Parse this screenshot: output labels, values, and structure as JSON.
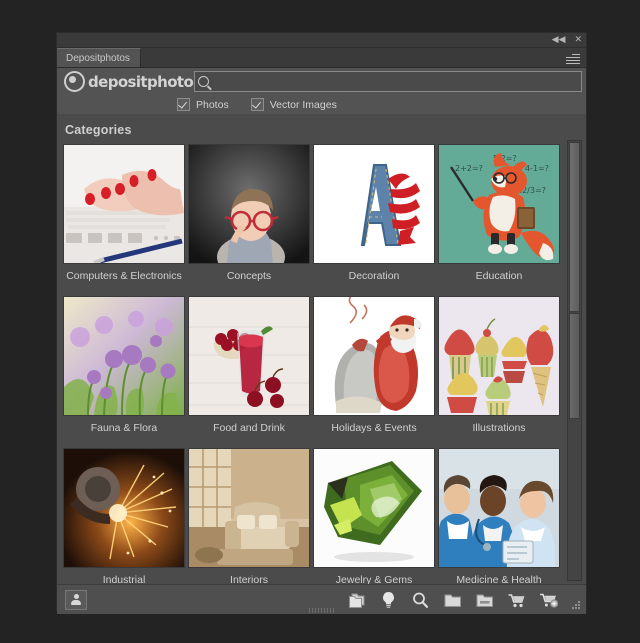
{
  "window": {
    "collapse_icon": "collapse-arrows-icon",
    "collapse_glyph": "◀◀",
    "close_glyph": "✕",
    "tab_label": "Depositphotos",
    "panel_menu_icon": "panel-menu-icon"
  },
  "brand": {
    "logo_text": "depositphotos",
    "logo_mark": "camera-aperture-icon"
  },
  "search": {
    "value": "",
    "placeholder": "",
    "icon": "search-icon"
  },
  "filters": [
    {
      "label": "Photos",
      "checked": true
    },
    {
      "label": "Vector Images",
      "checked": true
    }
  ],
  "main": {
    "section_title": "Categories",
    "categories": [
      {
        "label": "Computers & Electronics",
        "thumb": "hands-typing-on-white-keyboard",
        "bg": "#f2f0ee"
      },
      {
        "label": "Concepts",
        "thumb": "boy-with-red-glasses-thinking",
        "bg": "#3a3a3a"
      },
      {
        "label": "Decoration",
        "thumb": "denim-letter-A-with-red-ribbon",
        "bg": "#ffffff"
      },
      {
        "label": "Education",
        "thumb": "fox-teacher-with-pointer-and-math-equations",
        "bg": "#62ab96"
      },
      {
        "label": "Fauna & Flora",
        "thumb": "purple-chive-flowers-in-green-field",
        "bg": "#9dbf6a"
      },
      {
        "label": "Food and Drink",
        "thumb": "cherry-juice-glass-with-cherries",
        "bg": "#efe9e5"
      },
      {
        "label": "Holidays & Events",
        "thumb": "santa-claus-carrying-gift-sack",
        "bg": "#ffffff"
      },
      {
        "label": "Illustrations",
        "thumb": "cupcakes-and-ice-cream-drawings",
        "bg": "#ece7ee"
      },
      {
        "label": "Industrial",
        "thumb": "grinder-sparks-metal-work",
        "bg": "#3b2318"
      },
      {
        "label": "Interiors",
        "thumb": "living-room-with-beige-sofa",
        "bg": "#cdb99a"
      },
      {
        "label": "Jewelry & Gems",
        "thumb": "green-cut-gemstone",
        "bg": "#ffffff"
      },
      {
        "label": "Medicine & Health",
        "thumb": "three-doctors-in-scrubs",
        "bg": "#cfd8de"
      }
    ],
    "education_equations": [
      "2+2=?",
      "5·2=?",
      "4-1=?",
      "12/3=?"
    ]
  },
  "toolbar": {
    "user_icon": "user-account-icon",
    "actions": [
      {
        "icon": "files-stack-icon",
        "name": "my-files"
      },
      {
        "icon": "lightbulb-icon",
        "name": "lightbox"
      },
      {
        "icon": "search-icon",
        "name": "search"
      },
      {
        "icon": "folder-icon",
        "name": "folder"
      },
      {
        "icon": "folder-open-icon",
        "name": "downloads"
      },
      {
        "icon": "cart-icon",
        "name": "cart"
      },
      {
        "icon": "cart-add-icon",
        "name": "add-to-cart"
      }
    ],
    "resize_grip": "resize-grip-icon",
    "drag_handle": "drag-handle-icon"
  },
  "colors": {
    "panel_bg": "#535353",
    "body_bg": "#4b4b4b",
    "titlebar_bg": "#3a3a3a",
    "text": "#d0d0d0",
    "accent_tab": "#c8c8c8"
  }
}
